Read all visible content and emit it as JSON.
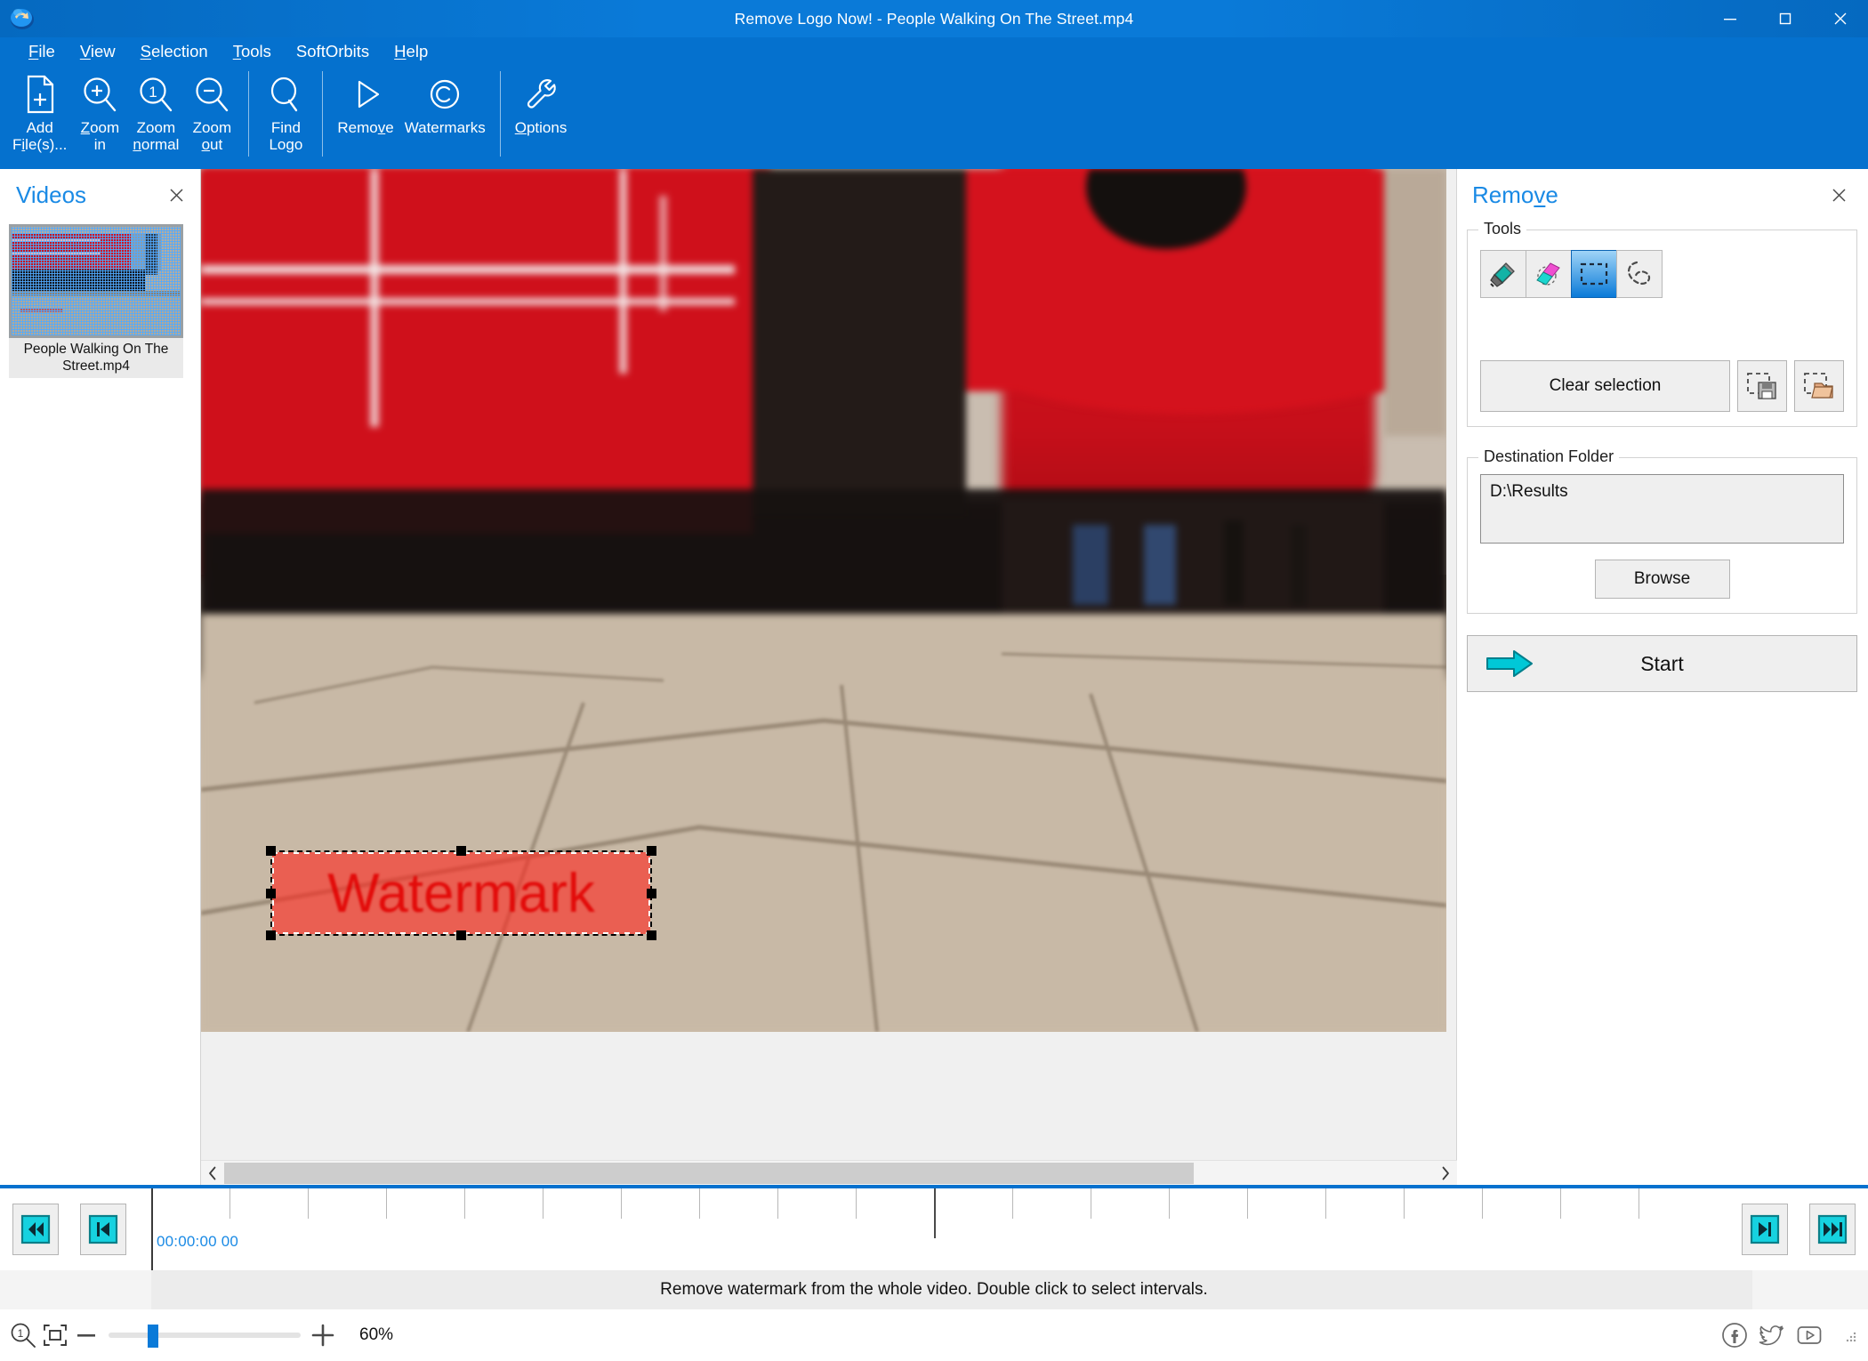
{
  "window": {
    "title": "Remove Logo Now! - People Walking On The Street.mp4",
    "app_icon": "app-logo-icon",
    "minimize": "–",
    "maximize": "☐",
    "close": "✕"
  },
  "menu": {
    "items": [
      {
        "label": "File",
        "accel": "F"
      },
      {
        "label": "View",
        "accel": "V"
      },
      {
        "label": "Selection",
        "accel": "S"
      },
      {
        "label": "Tools",
        "accel": "T"
      },
      {
        "label": "SoftOrbits",
        "accel": ""
      },
      {
        "label": "Help",
        "accel": "H"
      }
    ]
  },
  "toolbar": {
    "buttons": [
      {
        "label": "Add\nFile(s)...",
        "icon": "add-file-icon"
      },
      {
        "label": "Zoom\nin",
        "icon": "zoom-in-icon"
      },
      {
        "label": "Zoom\nnormal",
        "icon": "zoom-normal-icon"
      },
      {
        "label": "Zoom\nout",
        "icon": "zoom-out-icon"
      },
      {
        "label": "Find\nLogo",
        "icon": "find-logo-icon"
      },
      {
        "label": "Remove",
        "icon": "play-triangle-icon"
      },
      {
        "label": "Watermarks",
        "icon": "copyright-icon"
      },
      {
        "label": "Options",
        "icon": "wrench-icon"
      }
    ]
  },
  "videos_panel": {
    "title": "Videos",
    "close_icon": "close-icon",
    "items": [
      {
        "name": "People Walking On The Street.mp4",
        "selected": true
      }
    ]
  },
  "remove_panel": {
    "title": "Remove",
    "close_icon": "close-icon",
    "tools_group": {
      "legend": "Tools",
      "tools": [
        {
          "name": "marker-tool",
          "icon": "marker-icon",
          "active": false
        },
        {
          "name": "eraser-tool",
          "icon": "eraser-icon",
          "active": false
        },
        {
          "name": "rectangle-select-tool",
          "icon": "rectangle-select-icon",
          "active": true
        },
        {
          "name": "lasso-select-tool",
          "icon": "lasso-icon",
          "active": false
        }
      ],
      "clear_selection_label": "Clear selection",
      "save_selection_icon": "save-selection-icon",
      "load_selection_icon": "load-selection-icon"
    },
    "destination_group": {
      "legend": "Destination Folder",
      "path_value": "D:\\Results",
      "path_placeholder": "",
      "browse_label": "Browse"
    },
    "start_button": {
      "label": "Start",
      "icon": "arrow-right-icon"
    }
  },
  "canvas": {
    "watermark_text": "Watermark",
    "scroll_left_icon": "chevron-left-icon",
    "scroll_right_icon": "chevron-right-icon"
  },
  "timeline": {
    "timecode": "00:00:00 00",
    "buttons_left": [
      {
        "name": "rewind-to-start-button",
        "icon": "rewind-start-icon"
      },
      {
        "name": "previous-frame-button",
        "icon": "prev-frame-icon"
      }
    ],
    "buttons_right": [
      {
        "name": "next-frame-button",
        "icon": "next-frame-icon"
      },
      {
        "name": "forward-to-end-button",
        "icon": "forward-end-icon"
      }
    ]
  },
  "statusbar": {
    "message": "Remove watermark from the whole video. Double click to select intervals."
  },
  "zoombar": {
    "zoom_normal_icon": "zoom-normal-icon",
    "fit_icon": "fit-to-window-icon",
    "minus_label": "—",
    "plus_label": "＋",
    "zoom_value": "60%",
    "social": [
      {
        "name": "facebook-icon",
        "glyph": "f"
      },
      {
        "name": "twitter-icon",
        "glyph": "t"
      },
      {
        "name": "youtube-icon",
        "glyph": "y"
      }
    ]
  },
  "colors": {
    "accent_blue": "#0571ce",
    "title_blue": "#0a7ad8",
    "panel_title_blue": "#1a8ae5",
    "teal": "#00c8d7",
    "watermark_red": "#ff281e"
  }
}
